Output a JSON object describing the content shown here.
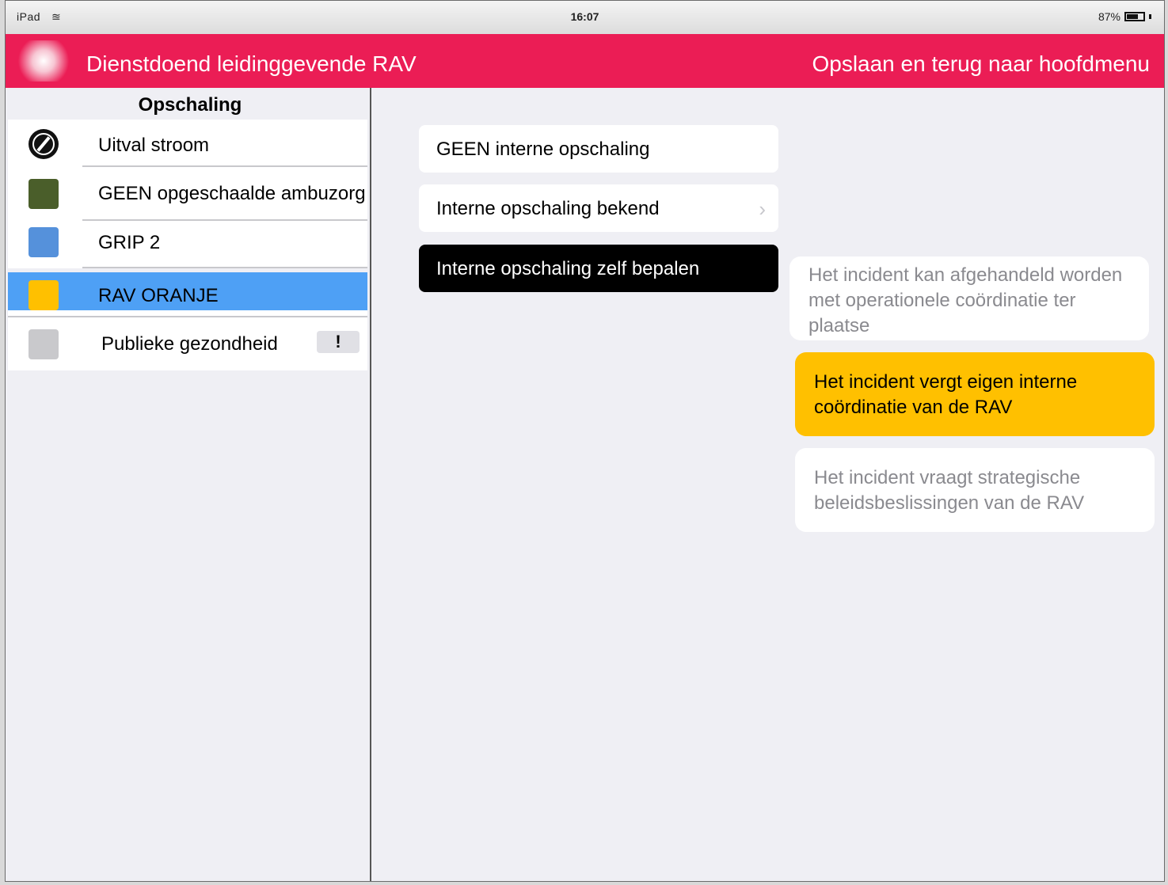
{
  "status": {
    "device": "iPad",
    "time": "16:07",
    "battery": "87%"
  },
  "header": {
    "title": "Dienstdoend leidinggevende RAV",
    "back_label": "Opslaan en terug naar hoofdmenu"
  },
  "sidebar": {
    "title": "Opschaling",
    "items": [
      {
        "label": "Uitval stroom",
        "icon": "compass-icon"
      },
      {
        "label": "GEEN opgeschaalde ambuzorg",
        "color": "#4a5e2a"
      },
      {
        "label": "GRIP 2",
        "color": "#5591db"
      },
      {
        "label": "RAV ORANJE",
        "color": "#ffc000"
      },
      {
        "label": "Publieke gezondheid",
        "color": "#c9c9cc",
        "badge": "!"
      }
    ]
  },
  "options": [
    {
      "label": "GEEN interne opschaling"
    },
    {
      "label": "Interne opschaling bekend"
    },
    {
      "label": "Interne opschaling zelf bepalen"
    }
  ],
  "cards": [
    {
      "text": "Het incident kan afgehandeld worden met operationele coördinatie ter plaatse"
    },
    {
      "text": "Het incident vergt eigen interne coördinatie van de RAV"
    },
    {
      "text": "Het incident vraagt strategische beleidsbeslissingen van de RAV"
    }
  ],
  "colors": {
    "header": "#eb1d55",
    "selected": "#4ea0f5",
    "accent": "#ffc000"
  }
}
